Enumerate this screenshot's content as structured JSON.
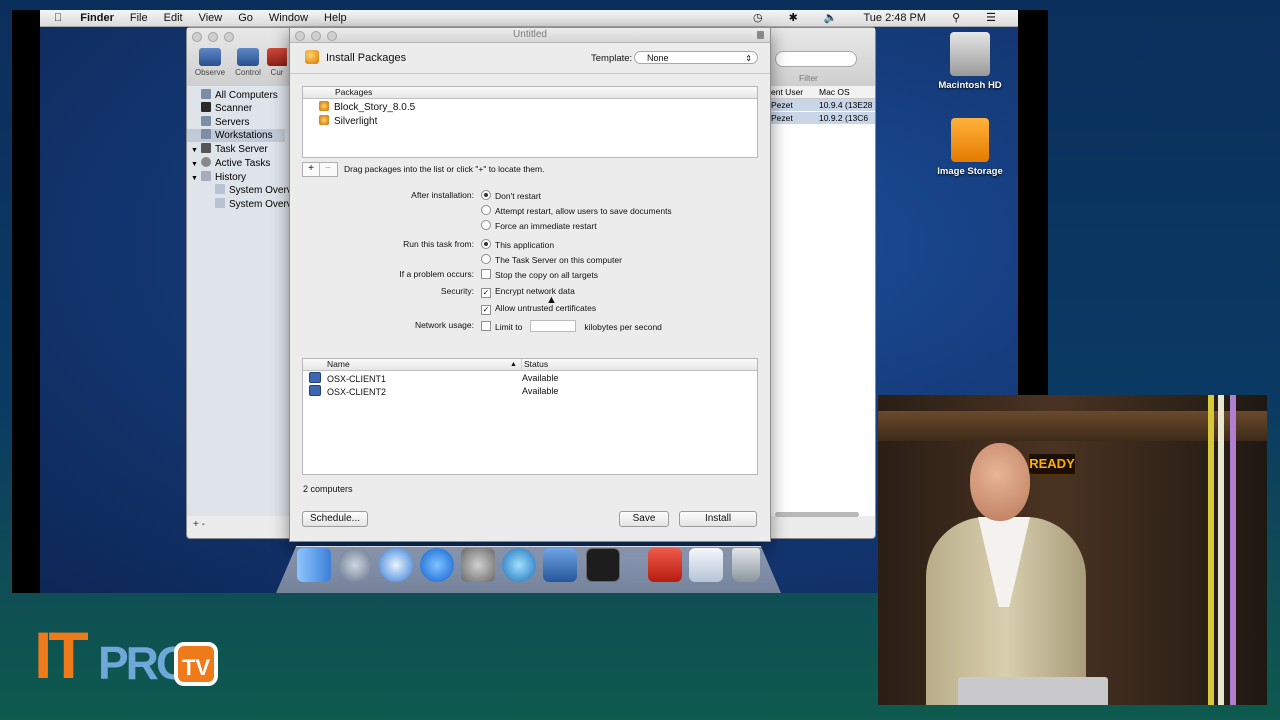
{
  "menubar": {
    "app": "Finder",
    "items": [
      "File",
      "Edit",
      "View",
      "Go",
      "Window",
      "Help"
    ],
    "clock": "Tue 2:48 PM"
  },
  "bg_window": {
    "toolbar": [
      "Observe",
      "Control",
      "Cur"
    ],
    "sidebar": [
      "All Computers",
      "Scanner",
      "Servers",
      "Workstations",
      "Task Server",
      "Active Tasks",
      "History",
      "System Overv",
      "System Overv"
    ],
    "filter_label": "Filter",
    "columns": [
      "ent User",
      "Mac OS Versic"
    ],
    "rows": [
      {
        "user": "Pezet",
        "os": "10.9.4 (13E28"
      },
      {
        "user": "Pezet",
        "os": "10.9.2 (13C6"
      }
    ],
    "add_label": "+ -"
  },
  "sheet": {
    "window_title": "Untitled",
    "title": "Install Packages",
    "template_label": "Template:",
    "template_value": "None",
    "packages_header": "Packages",
    "packages": [
      "Block_Story_8.0.5",
      "Silverlight"
    ],
    "add_btn": "+",
    "remove_btn": "−",
    "hint": "Drag packages into the list or click \"+\" to locate them.",
    "after_install_label": "After installation:",
    "after_install_opts": [
      "Don't restart",
      "Attempt restart, allow users to save documents",
      "Force an immediate restart"
    ],
    "run_from_label": "Run this task from:",
    "run_from_opts": [
      "This application",
      "The Task Server on this computer"
    ],
    "problem_label": "If a problem occurs:",
    "problem_opt": "Stop the copy on all targets",
    "security_label": "Security:",
    "security_opts": [
      "Encrypt network data",
      "Allow untrusted certificates"
    ],
    "network_label": "Network usage:",
    "network_opt": "Limit to",
    "network_unit": "kilobytes per second",
    "targets_cols": [
      "Name",
      "Status"
    ],
    "targets": [
      {
        "name": "OSX-CLIENT1",
        "status": "Available"
      },
      {
        "name": "OSX-CLIENT2",
        "status": "Available"
      }
    ],
    "count": "2 computers",
    "schedule_btn": "Schedule...",
    "save_btn": "Save",
    "install_btn": "Install"
  },
  "desktop_icons": [
    "Macintosh HD",
    "Image Storage"
  ],
  "webcam": {
    "sign": "READY"
  },
  "logo": {
    "it": "IT",
    "pro": "PRO",
    "tv": "TV"
  }
}
